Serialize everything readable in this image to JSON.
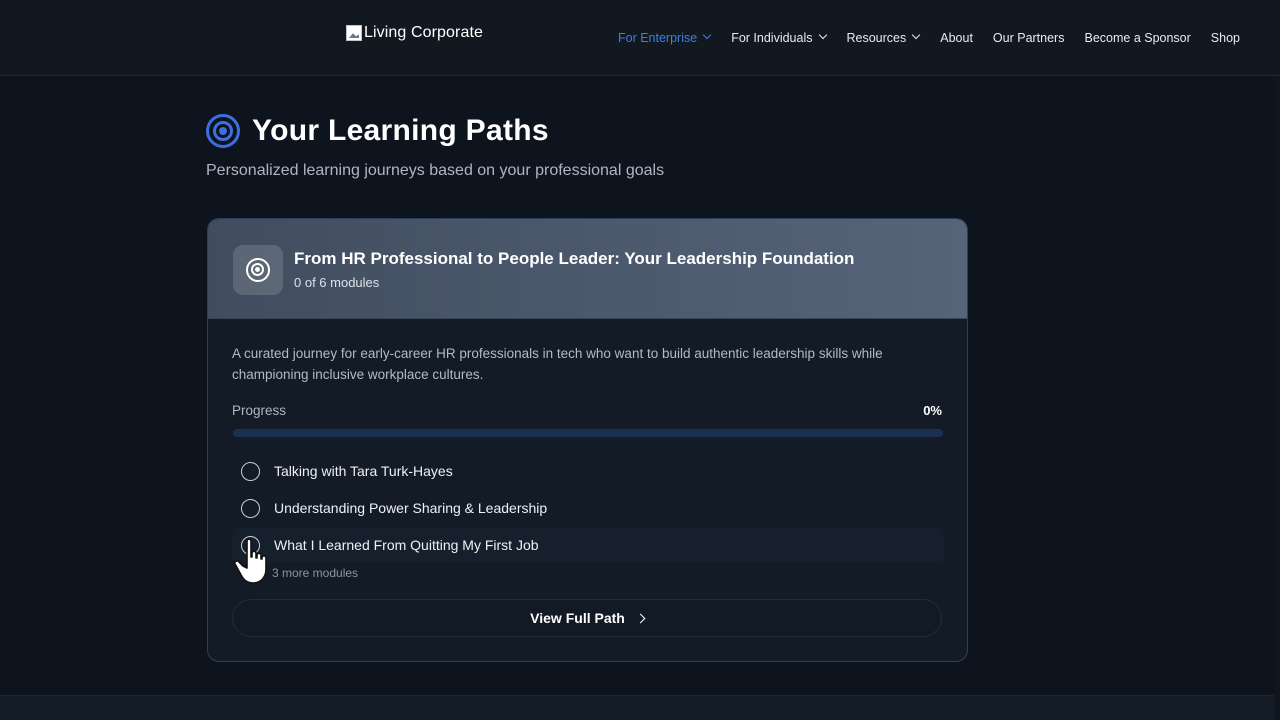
{
  "header": {
    "logo_text": "Living Corporate",
    "nav": [
      {
        "label": "For Enterprise",
        "dropdown": true,
        "active": true
      },
      {
        "label": "For Individuals",
        "dropdown": true,
        "active": false
      },
      {
        "label": "Resources",
        "dropdown": true,
        "active": false
      },
      {
        "label": "About",
        "dropdown": false,
        "active": false
      },
      {
        "label": "Our Partners",
        "dropdown": false,
        "active": false
      },
      {
        "label": "Become a Sponsor",
        "dropdown": false,
        "active": false
      },
      {
        "label": "Shop",
        "dropdown": false,
        "active": false
      }
    ]
  },
  "page": {
    "title": "Your Learning Paths",
    "subtitle": "Personalized learning journeys based on your professional goals",
    "title_icon": "target-icon"
  },
  "path_card": {
    "icon": "target-icon",
    "title": "From HR Professional to People Leader: Your Leadership Foundation",
    "module_count": "0 of 6 modules",
    "description": "A curated journey for early-career HR professionals in tech who want to build authentic leadership skills while championing inclusive workplace cultures.",
    "progress_label": "Progress",
    "progress_value": "0%",
    "progress_fraction": 0,
    "modules": [
      {
        "label": "Talking with Tara Turk-Hayes",
        "completed": false
      },
      {
        "label": "Understanding Power Sharing & Leadership",
        "completed": false
      },
      {
        "label": "What I Learned From Quitting My First Job",
        "completed": false
      }
    ],
    "more_modules": "3 more modules",
    "view_button": "View Full Path"
  },
  "colors": {
    "background": "#0e141d",
    "accent": "#3c6fe0",
    "nav_active": "#3d7fe0"
  }
}
